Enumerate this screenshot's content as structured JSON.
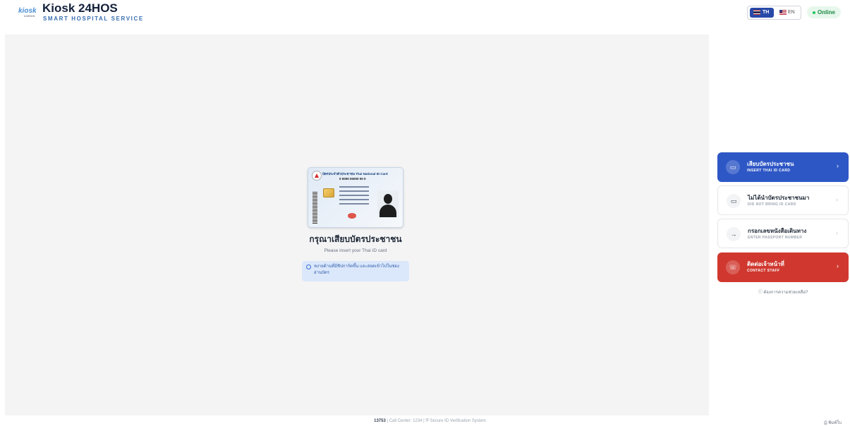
{
  "header": {
    "logo_text": "kiosk",
    "logo_sub": "24HOS",
    "title": "Kiosk 24HOS",
    "subtitle": "SMART HOSPITAL SERVICE",
    "lang_th": "TH",
    "lang_en": "EN",
    "status": "Online",
    "colors": {
      "brand": "#14213d",
      "accent": "#2e57c6",
      "status": "#22c55e"
    }
  },
  "card": {
    "title": "บัตรประจำตัวประชาชน Thai National ID Card",
    "number": "0 0000 00000 00 0"
  },
  "main": {
    "title": "กรุณาเสียบบัตรประชาชน",
    "subtitle": "Please insert your Thai ID card",
    "info": "หงายด้านที่มีชิปการ์ดขึ้น และสอดเข้าไปในช่องอ่านบัตร"
  },
  "options": [
    {
      "th": "เสียบบัตรประชาชน",
      "en": "INSERT THAI ID CARD",
      "icon": "id-card-icon"
    },
    {
      "th": "ไม่ได้นำบัตรประชาชนมา",
      "en": "DID NOT BRING ID CARD",
      "icon": "card-icon"
    },
    {
      "th": "กรอกเลขหนังสือเดินทาง",
      "en": "ENTER PASSPORT NUMBER",
      "icon": "arrow-right-icon"
    },
    {
      "th": "ติดต่อเจ้าหน้าที่",
      "en": "CONTACT STAFF",
      "icon": "phone-icon"
    }
  ],
  "help": "ต้องการความช่วยเหลือ?",
  "footer": {
    "id": "13753",
    "call_center": "Call Center: 1234",
    "system": "Secure ID Verification System",
    "print": "พิมพ์ใบ"
  }
}
